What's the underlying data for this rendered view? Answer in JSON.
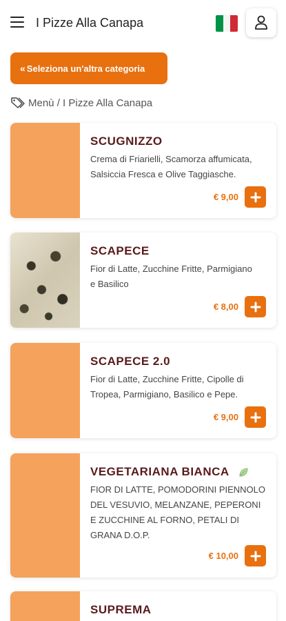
{
  "header": {
    "title": "I Pizze Alla Canapa",
    "menu_icon": "hamburger-menu-icon",
    "language_flag": "italy-flag-icon",
    "account_icon": "user-icon"
  },
  "category_button": {
    "chevron": "«",
    "label": "Seleziona un'altra categoria"
  },
  "breadcrumb": {
    "icon": "tag-icon",
    "root": "Menù",
    "separator": " / ",
    "current": "I Pizze Alla Canapa"
  },
  "colors": {
    "accent": "#e8700f",
    "placeholder": "#f4a25c",
    "product_name": "#5a1a1a",
    "flag_green": "#009246",
    "flag_white": "#ffffff",
    "flag_red": "#ce2b37"
  },
  "products": [
    {
      "name": "SCUGNIZZO",
      "description": "Crema di Friarielli, Scamorza affumicata, Salsiccia Fresca e Olive Taggiasche.",
      "price": "€ 9,00",
      "image": "placeholder"
    },
    {
      "name": "SCAPECE",
      "description": "Fior di Latte, Zucchine Fritte, Parmigiano e Basilico",
      "price": "€ 8,00",
      "image": "pizza-photo"
    },
    {
      "name": "SCAPECE 2.0",
      "description": "Fior di Latte, Zucchine Fritte, Cipolle di Tropea, Parmigiano, Basilico e Pepe.",
      "price": "€ 9,00",
      "image": "placeholder"
    },
    {
      "name": "VEGETARIANA BIANCA",
      "description": "FIOR DI LATTE, POMODORINI PIENNOLO DEL VESUVIO, MELANZANE, PEPERONI E ZUCCHINE AL FORNO, PETALI DI GRANA D.O.P.",
      "price": "€ 10,00",
      "image": "placeholder",
      "badge_icon": "vegetarian-leaf-icon"
    },
    {
      "name": "SUPREMA",
      "image": "placeholder"
    }
  ]
}
